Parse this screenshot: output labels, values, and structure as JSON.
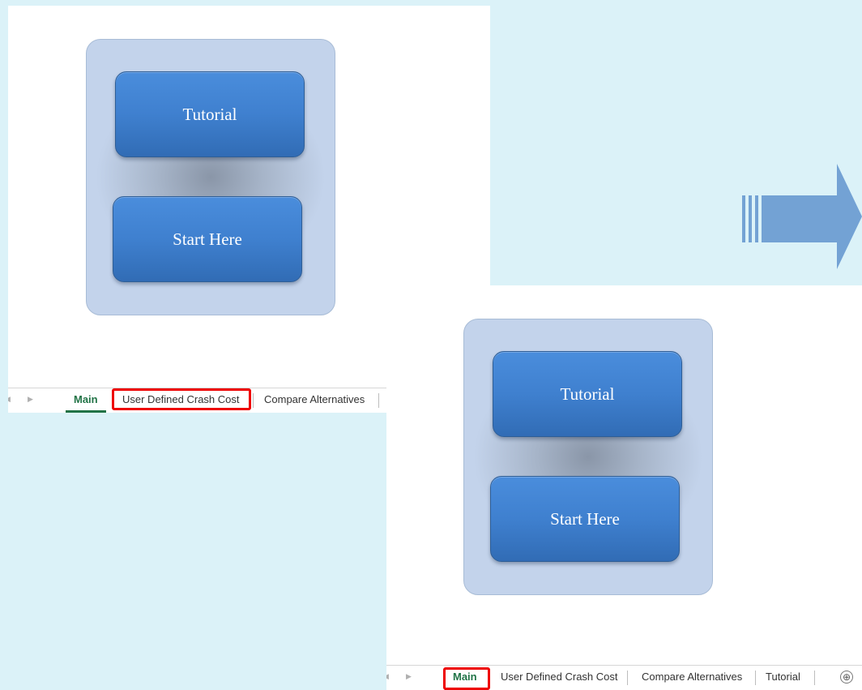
{
  "screenshots": [
    {
      "buttons": {
        "tutorial": "Tutorial",
        "start": "Start Here"
      },
      "tabs": [
        "Main",
        "User Defined Crash Cost",
        "Compare Alternatives"
      ],
      "active_tab": "Main",
      "highlighted_tab": "User Defined Crash Cost"
    },
    {
      "buttons": {
        "tutorial": "Tutorial",
        "start": "Start Here"
      },
      "tabs": [
        "Main",
        "User Defined Crash Cost",
        "Compare Alternatives",
        "Tutorial"
      ],
      "active_tab": "Main",
      "highlighted_tab": "Main",
      "add_sheet_symbol": "⊕"
    }
  ],
  "nav_arrows": {
    "prev": "◀",
    "next": "▶"
  },
  "colors": {
    "background": "#dbf2f8",
    "button": "#3f80cf",
    "highlight": "#ee0000",
    "active_tab": "#217346",
    "arrow": "#73a2d4"
  },
  "icons": {
    "arrow": "right-block-arrow-icon",
    "add_sheet": "plus-circle-icon"
  }
}
